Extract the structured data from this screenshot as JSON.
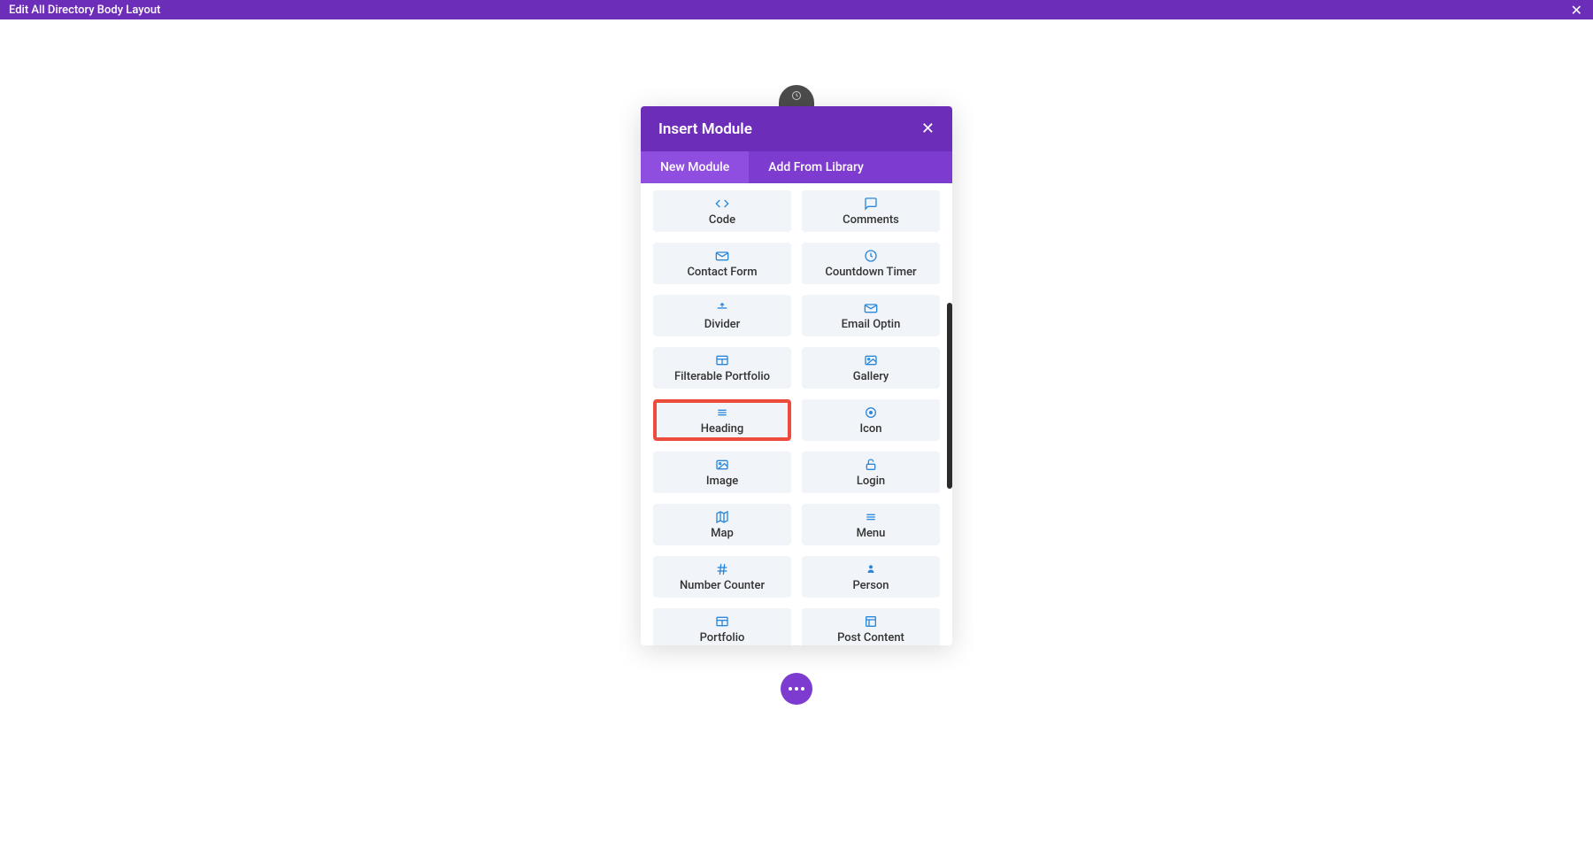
{
  "topbar": {
    "title": "Edit All Directory Body Layout"
  },
  "modal": {
    "title": "Insert Module",
    "tabs": {
      "new_module": "New Module",
      "add_from_library": "Add From Library"
    }
  },
  "modules": {
    "code": "Code",
    "comments": "Comments",
    "contact_form": "Contact Form",
    "countdown_timer": "Countdown Timer",
    "divider": "Divider",
    "email_optin": "Email Optin",
    "filterable_portfolio": "Filterable Portfolio",
    "gallery": "Gallery",
    "heading": "Heading",
    "icon": "Icon",
    "image": "Image",
    "login": "Login",
    "map": "Map",
    "menu": "Menu",
    "number_counter": "Number Counter",
    "person": "Person",
    "portfolio": "Portfolio",
    "post_content": "Post Content"
  }
}
